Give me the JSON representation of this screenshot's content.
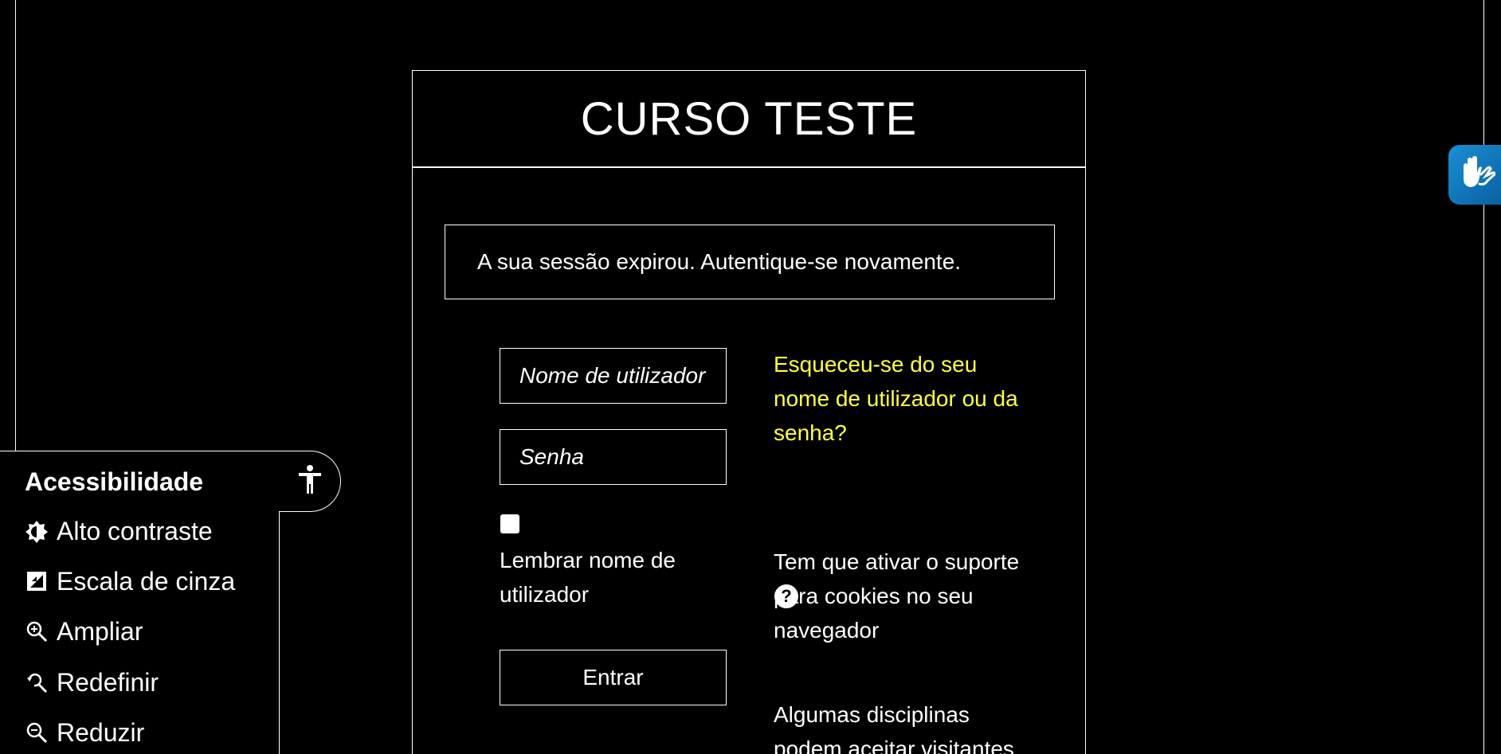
{
  "login": {
    "title": "CURSO TESTE",
    "alert": "A sua sessão expirou. Autentique-se novamente.",
    "username_placeholder": "Nome de utilizador",
    "password_placeholder": "Senha",
    "remember_label": "Lembrar nome de utilizador",
    "remember_checked": false,
    "submit_label": "Entrar",
    "forgot_link": "Esqueceu-se do seu nome de utilizador ou da senha?",
    "cookies_notice": "Tem que ativar o suporte para cookies no seu navegador",
    "guest_notice": "Algumas disciplinas podem aceitar visitantes"
  },
  "accessibility": {
    "title": "Acessibilidade",
    "items": [
      {
        "label": "Alto contraste",
        "icon": "contrast-icon"
      },
      {
        "label": "Escala de cinza",
        "icon": "grayscale-icon"
      },
      {
        "label": "Ampliar",
        "icon": "zoom-in-icon"
      },
      {
        "label": "Redefinir",
        "icon": "zoom-reset-icon"
      },
      {
        "label": "Reduzir",
        "icon": "zoom-out-icon"
      }
    ],
    "toggle_icon": "accessibility-person-icon"
  },
  "vlibras": {
    "icon": "sign-language-hands-icon",
    "color": "#1a8fd6"
  },
  "colors": {
    "background": "#000000",
    "text": "#ffffff",
    "link": "#ffff44"
  }
}
